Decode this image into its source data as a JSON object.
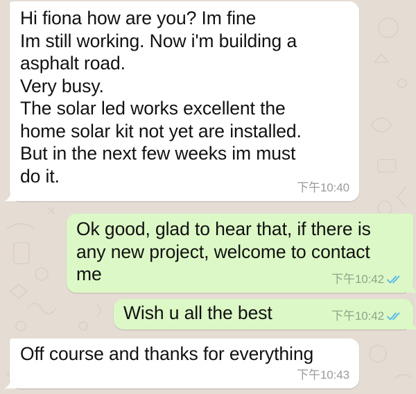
{
  "colors": {
    "background": "#e5ddd4",
    "incoming_bubble": "#ffffff",
    "outgoing_bubble": "#dcf8c6",
    "read_ticks": "#4fb6ec"
  },
  "messages": [
    {
      "direction": "incoming",
      "text": "Hi fiona how are you? Im fine\nIm still working. Now i'm building a\nasphalt road.\nVery busy.\nThe solar led works excellent the\nhome solar kit not yet are installed.\nBut in the next few weeks im must\ndo it.",
      "time": "下午10:40"
    },
    {
      "direction": "outgoing",
      "text": "Ok good, glad to hear that, if there is\nany new project, welcome to contact\nme",
      "time": "下午10:42",
      "status_icon": "double-check-icon"
    },
    {
      "direction": "outgoing",
      "text": "Wish u all the best",
      "time": "下午10:42",
      "status_icon": "double-check-icon"
    },
    {
      "direction": "incoming",
      "text": "Off course and thanks for everything",
      "time": "下午10:43"
    }
  ]
}
